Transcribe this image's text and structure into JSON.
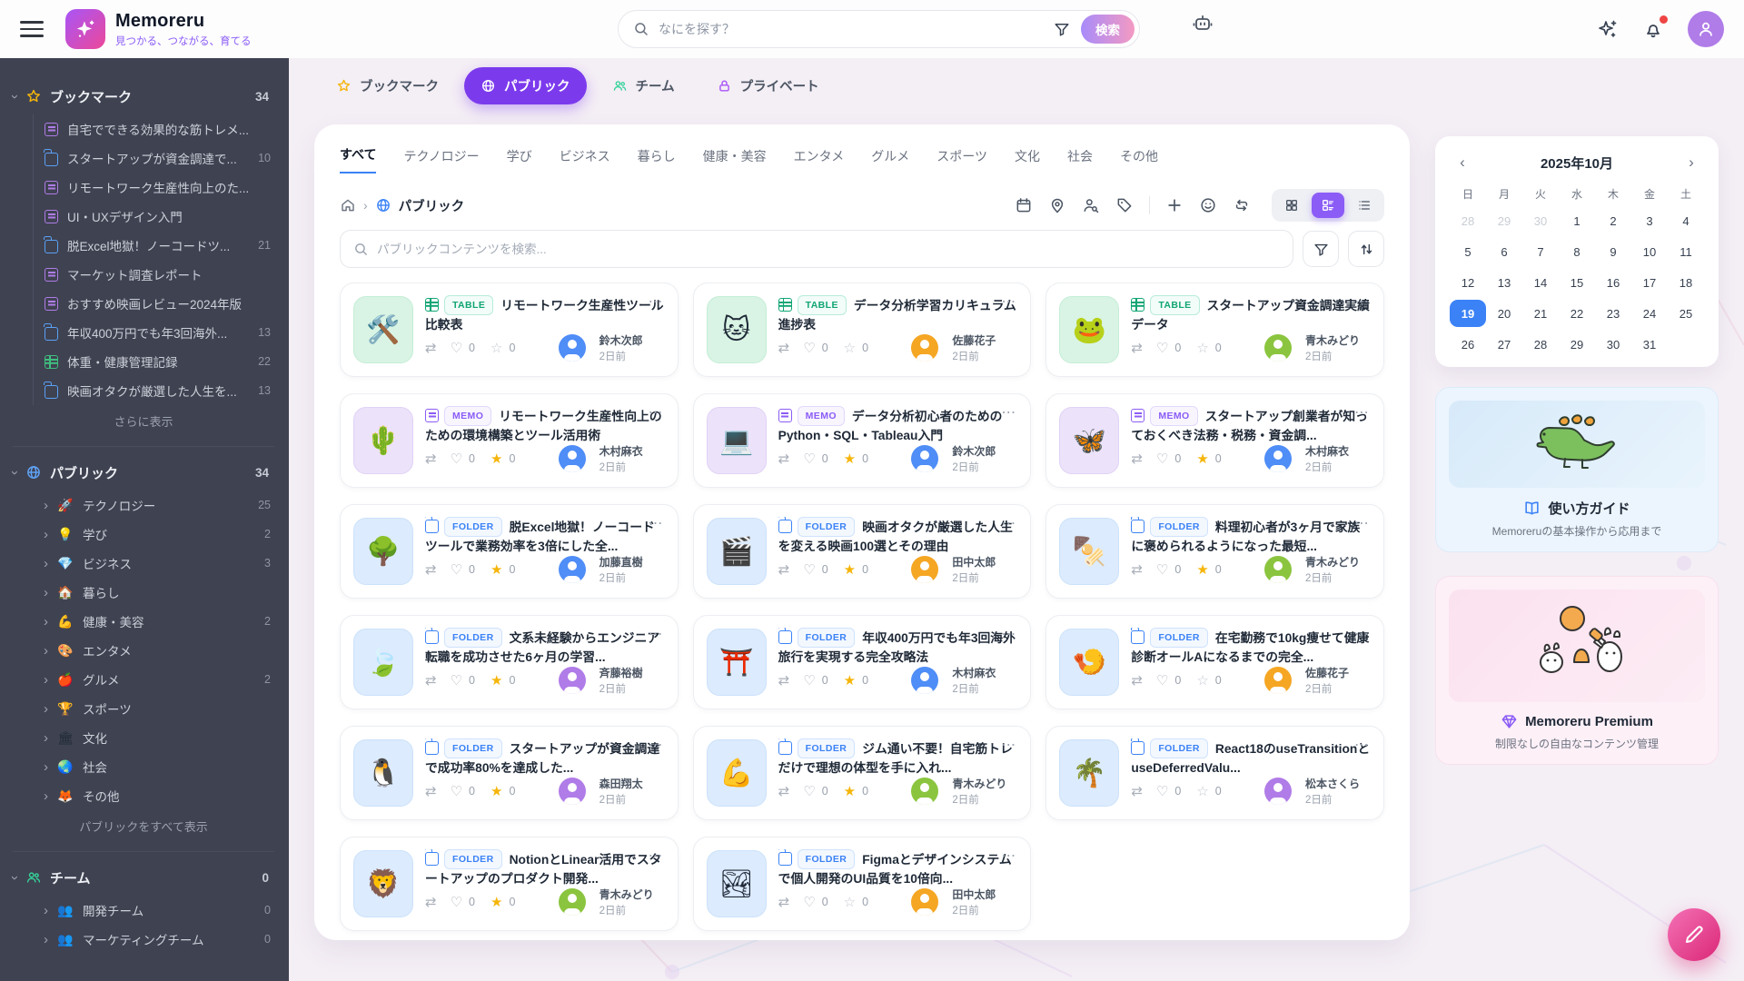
{
  "header": {
    "app_name": "Memoreru",
    "tagline": "見つかる、つながる、育てる",
    "search_placeholder": "なにを探す？",
    "search_button_label": "検索"
  },
  "sidebar": {
    "bookmarks": {
      "label": "ブックマーク",
      "count": "34",
      "show_more": "さらに表示",
      "items": [
        {
          "icon_cls": "fic memo",
          "label": "自宅でできる効果的な筋トレメ...",
          "count": ""
        },
        {
          "icon_cls": "fic folder",
          "label": "スタートアップが資金調達で...",
          "count": "10"
        },
        {
          "icon_cls": "fic memo",
          "label": "リモートワーク生産性向上のた...",
          "count": ""
        },
        {
          "icon_cls": "fic memo",
          "label": "UI・UXデザイン入門",
          "count": ""
        },
        {
          "icon_cls": "fic folder",
          "label": "脱Excel地獄！ノーコードツ...",
          "count": "21"
        },
        {
          "icon_cls": "fic memo",
          "label": "マーケット調査レポート",
          "count": ""
        },
        {
          "icon_cls": "fic memo",
          "label": "おすすめ映画レビュー2024年版",
          "count": ""
        },
        {
          "icon_cls": "fic folder",
          "label": "年収400万円でも年3回海外...",
          "count": "13"
        },
        {
          "icon_cls": "fic table",
          "label": "体重・健康管理記録",
          "count": "22"
        },
        {
          "icon_cls": "fic folder",
          "label": "映画オタクが厳選した人生を...",
          "count": "13"
        }
      ]
    },
    "public": {
      "label": "パブリック",
      "count": "34",
      "show_more": "パブリックをすべて表示",
      "items": [
        {
          "glyph": "🚀",
          "label": "テクノロジー",
          "count": "25"
        },
        {
          "glyph": "💡",
          "label": "学び",
          "count": "2"
        },
        {
          "glyph": "💎",
          "label": "ビジネス",
          "count": "3"
        },
        {
          "glyph": "🏠",
          "label": "暮らし",
          "count": ""
        },
        {
          "glyph": "💪",
          "label": "健康・美容",
          "count": "2"
        },
        {
          "glyph": "🎨",
          "label": "エンタメ",
          "count": ""
        },
        {
          "glyph": "🍎",
          "label": "グルメ",
          "count": "2"
        },
        {
          "glyph": "🏆",
          "label": "スポーツ",
          "count": ""
        },
        {
          "glyph": "🏛",
          "label": "文化",
          "count": ""
        },
        {
          "glyph": "🌏",
          "label": "社会",
          "count": ""
        },
        {
          "glyph": "🦊",
          "label": "その他",
          "count": ""
        }
      ]
    },
    "teams": {
      "label": "チーム",
      "count": "0",
      "items": [
        {
          "glyph": "👥",
          "label": "開発チーム",
          "count": "0"
        },
        {
          "glyph": "👥",
          "label": "マーケティングチーム",
          "count": "0"
        }
      ]
    }
  },
  "tabs": [
    {
      "label": "ブックマーク"
    },
    {
      "label": "パブリック"
    },
    {
      "label": "チーム"
    },
    {
      "label": "プライベート"
    }
  ],
  "categories": [
    {
      "label": "すべて",
      "cls": "cat-tab active"
    },
    {
      "label": "テクノロジー",
      "cls": "cat-tab"
    },
    {
      "label": "学び",
      "cls": "cat-tab"
    },
    {
      "label": "ビジネス",
      "cls": "cat-tab"
    },
    {
      "label": "暮らし",
      "cls": "cat-tab"
    },
    {
      "label": "健康・美容",
      "cls": "cat-tab"
    },
    {
      "label": "エンタメ",
      "cls": "cat-tab"
    },
    {
      "label": "グルメ",
      "cls": "cat-tab"
    },
    {
      "label": "スポーツ",
      "cls": "cat-tab"
    },
    {
      "label": "文化",
      "cls": "cat-tab"
    },
    {
      "label": "社会",
      "cls": "cat-tab"
    },
    {
      "label": "その他",
      "cls": "cat-tab"
    }
  ],
  "breadcrumb": {
    "current": "パブリック"
  },
  "content": {
    "search_placeholder": "パブリックコンテンツを検索..."
  },
  "cards": [
    {
      "badge": "TABLE",
      "badge_cls": "badge table",
      "tic_cls": "tic table",
      "thumb_cls": "thumb green",
      "glyph": "🛠️",
      "title": "リモートワーク生産性ツール比較表",
      "likes": "0",
      "stars": "0",
      "star_glyph": "☆",
      "star_cls": "st off",
      "author": "鈴木次郎",
      "time": "2日前",
      "avatar_color": "#4f8df7"
    },
    {
      "badge": "TABLE",
      "badge_cls": "badge table",
      "tic_cls": "tic table",
      "thumb_cls": "thumb green",
      "glyph": "🐱",
      "title": "データ分析学習カリキュラム進捗表",
      "likes": "0",
      "stars": "0",
      "star_glyph": "☆",
      "star_cls": "st off",
      "author": "佐藤花子",
      "time": "2日前",
      "avatar_color": "#f5a623"
    },
    {
      "badge": "TABLE",
      "badge_cls": "badge table",
      "tic_cls": "tic table",
      "thumb_cls": "thumb green",
      "glyph": "🐸",
      "title": "スタートアップ資金調達実績データ",
      "likes": "0",
      "stars": "0",
      "star_glyph": "☆",
      "star_cls": "st off",
      "author": "青木みどり",
      "time": "2日前",
      "avatar_color": "#8bc53f"
    },
    {
      "badge": "MEMO",
      "badge_cls": "badge memo",
      "tic_cls": "tic memo",
      "thumb_cls": "thumb purple",
      "glyph": "🌵",
      "title": "リモートワーク生産性向上のための環境構築とツール活用術",
      "likes": "0",
      "stars": "0",
      "star_glyph": "★",
      "star_cls": "st on",
      "author": "木村麻衣",
      "time": "2日前",
      "avatar_color": "#4f8df7"
    },
    {
      "badge": "MEMO",
      "badge_cls": "badge memo",
      "tic_cls": "tic memo",
      "thumb_cls": "thumb purple",
      "glyph": "💻",
      "title": "データ分析初心者のためのPython・SQL・Tableau入門",
      "likes": "0",
      "stars": "0",
      "star_glyph": "★",
      "star_cls": "st on",
      "author": "鈴木次郎",
      "time": "2日前",
      "avatar_color": "#4f8df7"
    },
    {
      "badge": "MEMO",
      "badge_cls": "badge memo",
      "tic_cls": "tic memo",
      "thumb_cls": "thumb purple",
      "glyph": "🦋",
      "title": "スタートアップ創業者が知っておくべき法務・税務・資金調...",
      "likes": "0",
      "stars": "0",
      "star_glyph": "★",
      "star_cls": "st on",
      "author": "木村麻衣",
      "time": "2日前",
      "avatar_color": "#4f8df7"
    },
    {
      "badge": "FOLDER",
      "badge_cls": "badge folder",
      "tic_cls": "tic folder",
      "thumb_cls": "thumb blue",
      "glyph": "🌳",
      "title": "脱Excel地獄！ノーコードツールで業務効率を3倍にした全...",
      "likes": "0",
      "stars": "0",
      "star_glyph": "★",
      "star_cls": "st on",
      "author": "加藤直樹",
      "time": "2日前",
      "avatar_color": "#4f8df7"
    },
    {
      "badge": "FOLDER",
      "badge_cls": "badge folder",
      "tic_cls": "tic folder",
      "thumb_cls": "thumb blue",
      "glyph": "🎬",
      "title": "映画オタクが厳選した人生を変える映画100選とその理由",
      "likes": "0",
      "stars": "0",
      "star_glyph": "★",
      "star_cls": "st on",
      "author": "田中太郎",
      "time": "2日前",
      "avatar_color": "#f5a623"
    },
    {
      "badge": "FOLDER",
      "badge_cls": "badge folder",
      "tic_cls": "tic folder",
      "thumb_cls": "thumb blue",
      "glyph": "🍢",
      "title": "料理初心者が3ヶ月で家族に褒められるようになった最短...",
      "likes": "0",
      "stars": "0",
      "star_glyph": "★",
      "star_cls": "st on",
      "author": "青木みどり",
      "time": "2日前",
      "avatar_color": "#8bc53f"
    },
    {
      "badge": "FOLDER",
      "badge_cls": "badge folder",
      "tic_cls": "tic folder",
      "thumb_cls": "thumb blue",
      "glyph": "🍃",
      "title": "文系未経験からエンジニア転職を成功させた6ヶ月の学習...",
      "likes": "0",
      "stars": "0",
      "star_glyph": "★",
      "star_cls": "st on",
      "author": "斉藤裕樹",
      "time": "2日前",
      "avatar_color": "#b07ce8"
    },
    {
      "badge": "FOLDER",
      "badge_cls": "badge folder",
      "tic_cls": "tic folder",
      "thumb_cls": "thumb blue",
      "glyph": "⛩️",
      "title": "年収400万円でも年3回海外旅行を実現する完全攻略法",
      "likes": "0",
      "stars": "0",
      "star_glyph": "★",
      "star_cls": "st on",
      "author": "木村麻衣",
      "time": "2日前",
      "avatar_color": "#4f8df7"
    },
    {
      "badge": "FOLDER",
      "badge_cls": "badge folder",
      "tic_cls": "tic folder",
      "thumb_cls": "thumb blue",
      "glyph": "🍤",
      "title": "在宅勤務で10kg痩せて健康診断オールAになるまでの完全...",
      "likes": "0",
      "stars": "0",
      "star_glyph": "☆",
      "star_cls": "st off",
      "author": "佐藤花子",
      "time": "2日前",
      "avatar_color": "#f5a623"
    },
    {
      "badge": "FOLDER",
      "badge_cls": "badge folder",
      "tic_cls": "tic folder",
      "thumb_cls": "thumb blue",
      "glyph": "🐧",
      "title": "スタートアップが資金調達で成功率80%を達成した...",
      "likes": "0",
      "stars": "0",
      "star_glyph": "★",
      "star_cls": "st on",
      "author": "森田翔太",
      "time": "2日前",
      "avatar_color": "#b07ce8"
    },
    {
      "badge": "FOLDER",
      "badge_cls": "badge folder",
      "tic_cls": "tic folder",
      "thumb_cls": "thumb blue",
      "glyph": "💪",
      "title": "ジム通い不要！自宅筋トレだけで理想の体型を手に入れ...",
      "likes": "0",
      "stars": "0",
      "star_glyph": "★",
      "star_cls": "st on",
      "author": "青木みどり",
      "time": "2日前",
      "avatar_color": "#8bc53f"
    },
    {
      "badge": "FOLDER",
      "badge_cls": "badge folder",
      "tic_cls": "tic folder",
      "thumb_cls": "thumb blue",
      "glyph": "🌴",
      "title": "React18のuseTransitionとuseDeferredValu...",
      "likes": "0",
      "stars": "0",
      "star_glyph": "☆",
      "star_cls": "st off",
      "author": "松本さくら",
      "time": "2日前",
      "avatar_color": "#b07ce8"
    },
    {
      "badge": "FOLDER",
      "badge_cls": "badge folder",
      "tic_cls": "tic folder",
      "thumb_cls": "thumb blue",
      "glyph": "🦁",
      "title": "NotionとLinear活用でスタートアップのプロダクト開発...",
      "likes": "0",
      "stars": "0",
      "star_glyph": "★",
      "star_cls": "st on",
      "author": "青木みどり",
      "time": "2日前",
      "avatar_color": "#8bc53f"
    },
    {
      "badge": "FOLDER",
      "badge_cls": "badge folder",
      "tic_cls": "tic folder",
      "thumb_cls": "thumb blue",
      "glyph": "🏞",
      "title": "Figmaとデザインシステムで個人開発のUI品質を10倍向...",
      "likes": "0",
      "stars": "0",
      "star_glyph": "☆",
      "star_cls": "st off",
      "author": "田中太郎",
      "time": "2日前",
      "avatar_color": "#f5a623"
    }
  ],
  "calendar": {
    "title": "2025年10月",
    "weekdays": [
      {
        "label": "日"
      },
      {
        "label": "月"
      },
      {
        "label": "火"
      },
      {
        "label": "水"
      },
      {
        "label": "木"
      },
      {
        "label": "金"
      },
      {
        "label": "土"
      }
    ],
    "days": [
      {
        "d": "28",
        "cls": "day muted"
      },
      {
        "d": "29",
        "cls": "day muted"
      },
      {
        "d": "30",
        "cls": "day muted"
      },
      {
        "d": "1",
        "cls": "day"
      },
      {
        "d": "2",
        "cls": "day"
      },
      {
        "d": "3",
        "cls": "day"
      },
      {
        "d": "4",
        "cls": "day"
      },
      {
        "d": "5",
        "cls": "day"
      },
      {
        "d": "6",
        "cls": "day"
      },
      {
        "d": "7",
        "cls": "day"
      },
      {
        "d": "8",
        "cls": "day"
      },
      {
        "d": "9",
        "cls": "day"
      },
      {
        "d": "10",
        "cls": "day"
      },
      {
        "d": "11",
        "cls": "day"
      },
      {
        "d": "12",
        "cls": "day"
      },
      {
        "d": "13",
        "cls": "day"
      },
      {
        "d": "14",
        "cls": "day"
      },
      {
        "d": "15",
        "cls": "day"
      },
      {
        "d": "16",
        "cls": "day"
      },
      {
        "d": "17",
        "cls": "day"
      },
      {
        "d": "18",
        "cls": "day"
      },
      {
        "d": "19",
        "cls": "day selected"
      },
      {
        "d": "20",
        "cls": "day"
      },
      {
        "d": "21",
        "cls": "day"
      },
      {
        "d": "22",
        "cls": "day"
      },
      {
        "d": "23",
        "cls": "day"
      },
      {
        "d": "24",
        "cls": "day"
      },
      {
        "d": "25",
        "cls": "day"
      },
      {
        "d": "26",
        "cls": "day"
      },
      {
        "d": "27",
        "cls": "day"
      },
      {
        "d": "28",
        "cls": "day"
      },
      {
        "d": "29",
        "cls": "day"
      },
      {
        "d": "30",
        "cls": "day"
      },
      {
        "d": "31",
        "cls": "day"
      },
      {
        "d": "",
        "cls": "day"
      }
    ]
  },
  "promos": [
    {
      "title": "使い方ガイド",
      "subtitle": "Memoreruの基本操作から応用まで"
    },
    {
      "title": "Memoreru Premium",
      "subtitle": "制限なしの自由なコンテンツ管理"
    }
  ]
}
